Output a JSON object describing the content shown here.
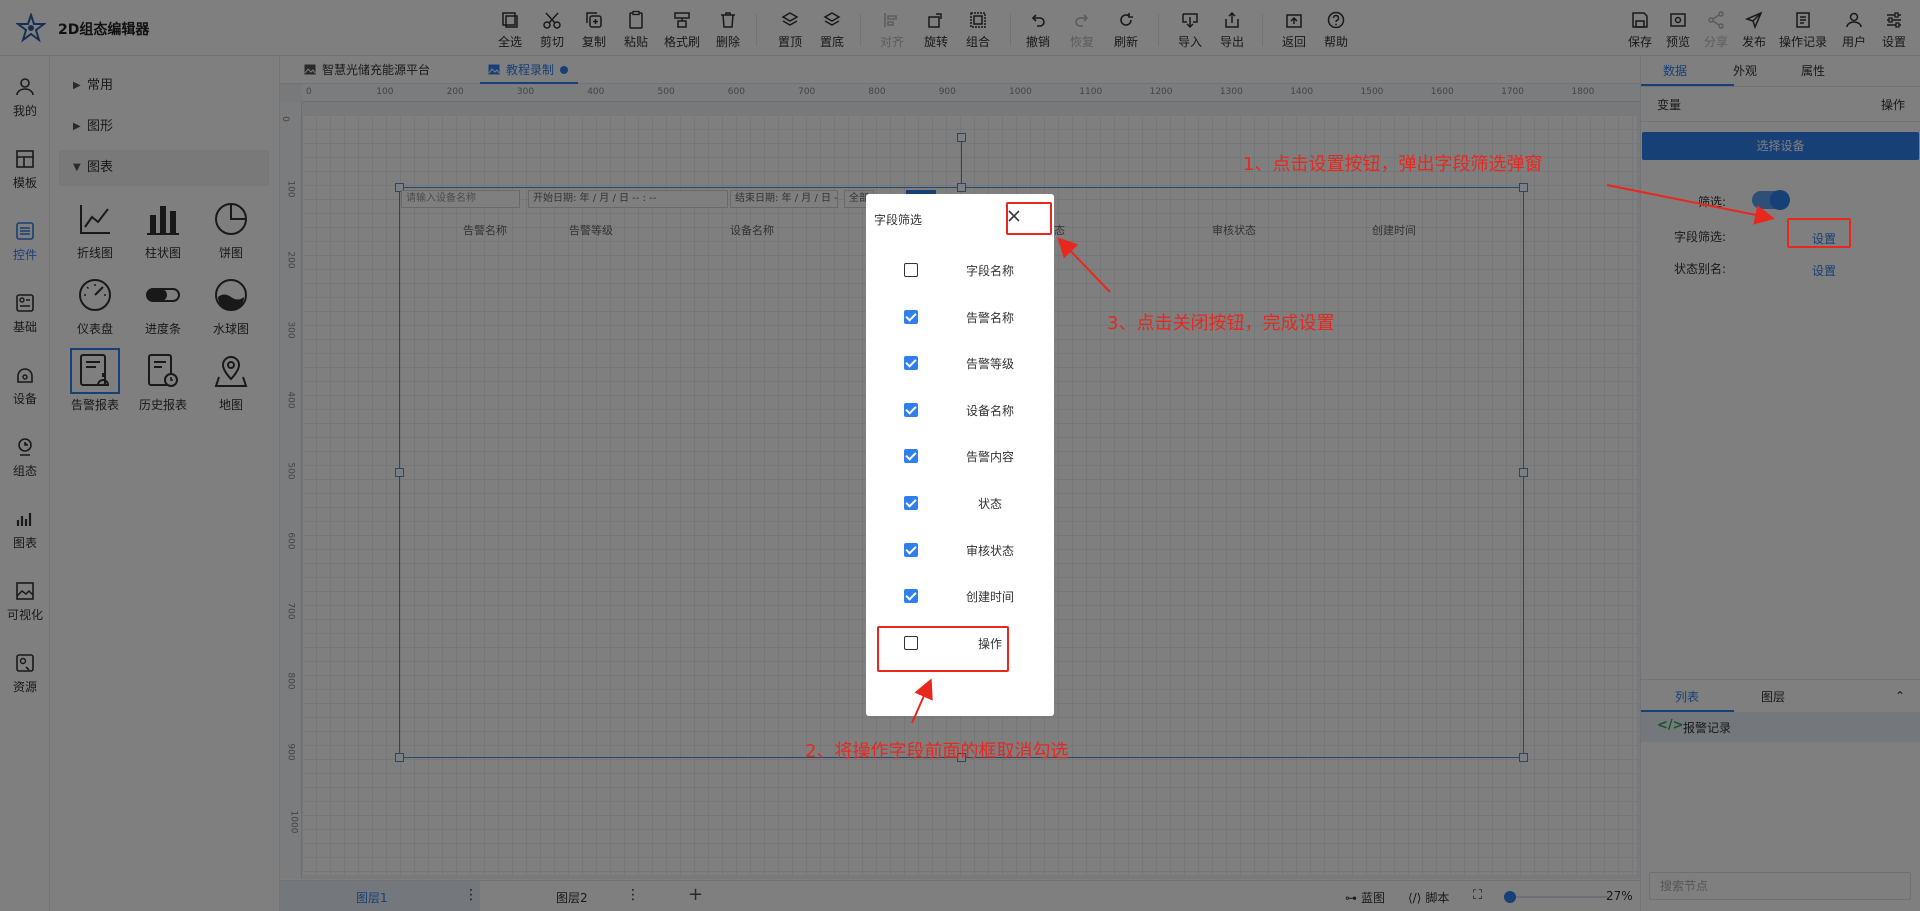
{
  "app": {
    "title": "2D组态编辑器"
  },
  "toolbar": {
    "select_all": "全选",
    "cut": "剪切",
    "copy": "复制",
    "paste": "粘贴",
    "format_brush": "格式刷",
    "delete": "删除",
    "bring_top": "置顶",
    "send_bottom": "置底",
    "align": "对齐",
    "rotate": "旋转",
    "group": "组合",
    "undo": "撤销",
    "redo": "恢复",
    "refresh": "刷新",
    "import": "导入",
    "export": "导出",
    "back": "返回",
    "help": "帮助",
    "save": "保存",
    "preview": "预览",
    "share": "分享",
    "publish": "发布",
    "operation_log": "操作记录",
    "user": "用户",
    "settings": "设置"
  },
  "leftnav": {
    "items": [
      {
        "label": "我的"
      },
      {
        "label": "模板"
      },
      {
        "label": "控件"
      },
      {
        "label": "基础"
      },
      {
        "label": "设备"
      },
      {
        "label": "组态"
      },
      {
        "label": "图表"
      },
      {
        "label": "可视化"
      },
      {
        "label": "资源"
      }
    ]
  },
  "components": {
    "categories": [
      {
        "label": "常用"
      },
      {
        "label": "图形"
      },
      {
        "label": "图表"
      }
    ],
    "tiles": [
      {
        "label": "折线图"
      },
      {
        "label": "柱状图"
      },
      {
        "label": "饼图"
      },
      {
        "label": "仪表盘"
      },
      {
        "label": "进度条"
      },
      {
        "label": "水球图"
      },
      {
        "label": "告警报表"
      },
      {
        "label": "历史报表"
      },
      {
        "label": "地图"
      }
    ]
  },
  "page_tabs": [
    {
      "label": "智慧光储充能源平台"
    },
    {
      "label": "教程录制"
    }
  ],
  "ruler": {
    "h": [
      "0",
      "100",
      "200",
      "300",
      "400",
      "500",
      "600",
      "700",
      "800",
      "900",
      "1000",
      "1100",
      "1200",
      "1300",
      "1400",
      "1500",
      "1600",
      "1700",
      "1800",
      "1900"
    ],
    "v": [
      "0",
      "100",
      "200",
      "300",
      "400",
      "500",
      "600",
      "700",
      "800",
      "900",
      "1000"
    ]
  },
  "widget": {
    "search_placeholder": "请输入设备名称",
    "start_date": "开始日期:  年 / 月 / 日  -- : --",
    "end_date": "结束日期:  年 / 月 / 日  -- : --",
    "filter_all": "全部",
    "columns": [
      "告警名称",
      "告警等级",
      "设备名称",
      "态",
      "审核状态",
      "创建时间"
    ]
  },
  "right_panel": {
    "tabs": [
      "数据",
      "外观",
      "属性"
    ],
    "variable": "变量",
    "operation": "操作",
    "select_device": "选择设备",
    "filter_label": "筛选:",
    "field_filter_label": "字段筛选:",
    "field_filter_link": "设置",
    "status_alias_label": "状态别名:",
    "status_alias_link": "设置",
    "list_tabs": [
      "列表",
      "图层"
    ],
    "list_item": "报警记录",
    "search_placeholder": "搜索节点"
  },
  "bottom": {
    "layer1": "图层1",
    "layer2": "图层2",
    "blueprint": "蓝图",
    "script": "脚本",
    "zoom": "27%"
  },
  "dialog": {
    "title": "字段筛选",
    "fields": [
      {
        "label": "字段名称",
        "checked": false
      },
      {
        "label": "告警名称",
        "checked": true
      },
      {
        "label": "告警等级",
        "checked": true
      },
      {
        "label": "设备名称",
        "checked": true
      },
      {
        "label": "告警内容",
        "checked": true
      },
      {
        "label": "状态",
        "checked": true
      },
      {
        "label": "审核状态",
        "checked": true
      },
      {
        "label": "创建时间",
        "checked": true
      },
      {
        "label": "操作",
        "checked": false
      }
    ]
  },
  "annotations": {
    "step1": "1、点击设置按钮，弹出字段筛选弹窗",
    "step2": "2、将操作字段前面的框取消勾选",
    "step3": "3、点击关闭按钮，完成设置"
  },
  "colors": {
    "accent": "#2f80ed",
    "annotation": "#e8281e"
  }
}
